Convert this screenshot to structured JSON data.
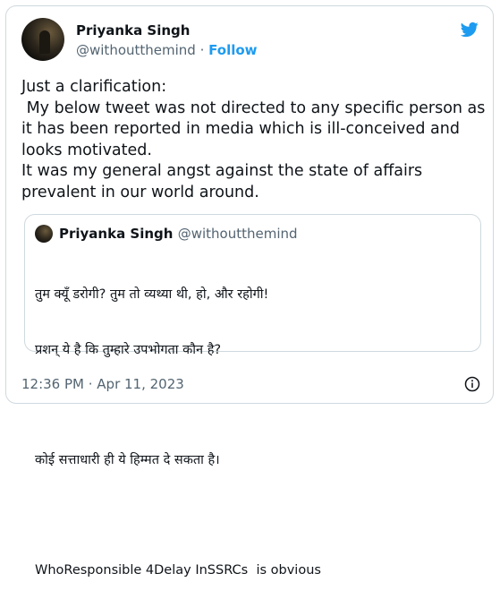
{
  "author": {
    "name": "Priyanka Singh",
    "handle": "@withoutthemind",
    "separator": " · ",
    "follow_label": "Follow"
  },
  "tweet": {
    "text": "Just a clarification:\n My below tweet was not directed to any specific person as it has been reported in media which is ill-conceived and looks motivated.\nIt was my general angst against the state of affairs prevalent in our world around."
  },
  "quoted": {
    "name": "Priyanka Singh",
    "handle": "@withoutthemind",
    "lines": [
      "तुम क्यूँ डरोगी? तुम तो व्यथ्या थी, हो, और रहोगी!",
      "प्रशन् ये है कि तुम्हारे उपभोगता कौन है?",
      "",
      "कोई सत्ताधारी ही ये हिम्मत दे सकता है।",
      "",
      "WhoResponsible 4Delay InSSRCs  is obvious"
    ]
  },
  "footer": {
    "timestamp": "12:36 PM · Apr 11, 2023"
  },
  "icons": {
    "brand": "twitter-bird-icon",
    "info": "info-icon"
  },
  "colors": {
    "brand": "#1d9bf0",
    "text": "#0f1419",
    "muted": "#536471",
    "border": "#cfd9de"
  }
}
